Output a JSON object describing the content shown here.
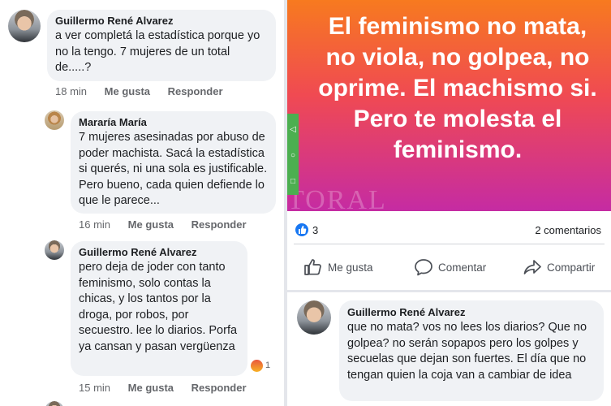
{
  "comments": [
    {
      "name": "Guillermo René Alvarez",
      "text": "a ver completá la estadística porque yo no la tengo. 7 mujeres de un total de.....?",
      "time": "18 min",
      "like": "Me gusta",
      "reply": "Responder"
    },
    {
      "name": "Mararía María",
      "text": "7 mujeres asesinadas por abuso de poder machista. Sacá la estadística si querés, ni una sola es justificable. Pero bueno, cada quien defiende lo que le parece...",
      "time": "16 min",
      "like": "Me gusta",
      "reply": "Responder"
    },
    {
      "name": "Guillermo René Alvarez",
      "text": "pero deja de joder con tanto feminismo, solo contas la chicas, y los tantos por la droga, por robos, por secuestro. lee lo diarios. Porfa ya cansan y pasan vergüenza",
      "time": "15 min",
      "like": "Me gusta",
      "reply": "Responder",
      "reaction_count": "1"
    }
  ],
  "post": {
    "image_text": "El feminismo no mata,\nno viola, no golpea, no\noprime. El machismo si.\nPero te molesta el\nfeminismo.",
    "watermark": "TORAL",
    "likes": "3",
    "comments_count": "2 comentarios",
    "actions": {
      "like": "Me gusta",
      "comment": "Comentar",
      "share": "Compartir"
    }
  },
  "post_comment": {
    "name": "Guillermo René Alvarez",
    "text": "que no mata? vos no lees los diarios? Que no golpea? no serán sopapos pero los golpes y secuelas que dejan son fuertes. El día que no tengan quien la coja van a cambiar de idea"
  },
  "colors": {
    "bubble": "#f0f2f5",
    "facebook_blue": "#1877f2",
    "muted_text": "#65676b",
    "gradient_top": "#f77a1f",
    "gradient_bottom": "#c52ba3"
  },
  "icons": [
    "like-reaction-icon",
    "thumbs-up-icon",
    "comment-icon",
    "share-icon",
    "angry-reaction-icon",
    "back-icon",
    "home-icon",
    "recents-icon"
  ]
}
